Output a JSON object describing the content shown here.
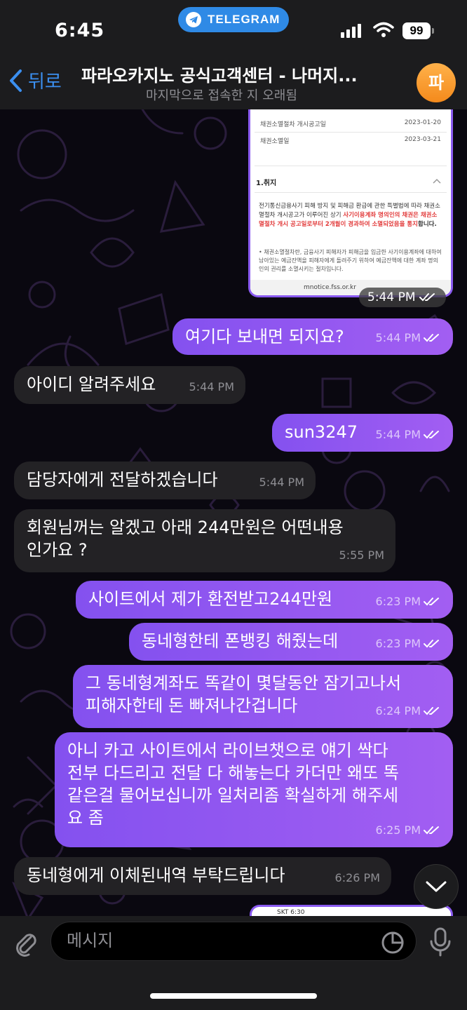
{
  "status_bar": {
    "time": "6:45",
    "app_pill": "TELEGRAM",
    "battery": "99"
  },
  "header": {
    "back_label": "뒤로",
    "title": "파라오카지노 공식고객센터 - 나머지...",
    "subtitle": "마지막으로 접속한 지 오래됨",
    "avatar_letter": "파"
  },
  "screenshot": {
    "row1_label": "채권소멸절차 개시공고일",
    "row1_value": "2023-01-20",
    "row2_label": "채권소멸일",
    "row2_value": "2023-03-21",
    "section_heading": "1.취지",
    "para_plain": "전기통신금융사기 피해 방지 및 피해금 환급에 관한 특별법에 따라 채권소멸절차 개시공고가 이루어진 상기 ",
    "para_red": "사기이용계좌 명의인의 채권은 채권소멸절차 개시 공고일로부터 2개월이 경과하여 소멸되었음을 통지",
    "para_end": "합니다.",
    "bullet": "• 채권소멸절차란, 금융사기 피해자가 피해금을 입금한 사기이용계좌에 대하여 남아있는 예금잔액을 피해자에게 돌려주기 위하여 예금잔액에 대한 계좌 명의인의 권리를 소멸시키는 절차입니다.",
    "url": "mnotice.fss.or.kr",
    "time": "5:44 PM"
  },
  "messages": [
    {
      "dir": "out",
      "text": "여기다 보내면 되지요?",
      "time": "5:44 PM"
    },
    {
      "dir": "in",
      "text": "아이디 알려주세요",
      "time": "5:44 PM"
    },
    {
      "dir": "out",
      "text": "sun3247",
      "time": "5:44 PM"
    },
    {
      "dir": "in",
      "text": "담당자에게 전달하겠습니다",
      "time": "5:44 PM"
    },
    {
      "dir": "in",
      "text": "회원님꺼는 알겠고 아래 244만원은 어떤내용\n인가요 ?",
      "time": "5:55 PM"
    },
    {
      "dir": "out",
      "text": "사이트에서 제가 환전받고244만원",
      "time": "6:23 PM"
    },
    {
      "dir": "out",
      "text": "동네형한테 폰뱅킹 해줬는데",
      "time": "6:23 PM"
    },
    {
      "dir": "out",
      "text": "그 동네형계좌도 똑같이 몇달동안 잠기고나서\n피해자한테 돈 빠져나간겁니다",
      "time": "6:24 PM"
    },
    {
      "dir": "out",
      "text": "아니 카고 사이트에서 라이브챗으로 얘기 싹다\n전부 다드리고 전달 다 해놓는다 카더만 왜또 똑\n같은걸 물어보십니까 일처리좀 확실하게 해주세\n요 좀",
      "time": "6:25 PM"
    },
    {
      "dir": "in",
      "text": "동네형에게 이체된내역 부탁드립니다",
      "time": "6:26 PM"
    }
  ],
  "preview": {
    "text": "SKT 6:30"
  },
  "composer": {
    "placeholder": "메시지"
  }
}
